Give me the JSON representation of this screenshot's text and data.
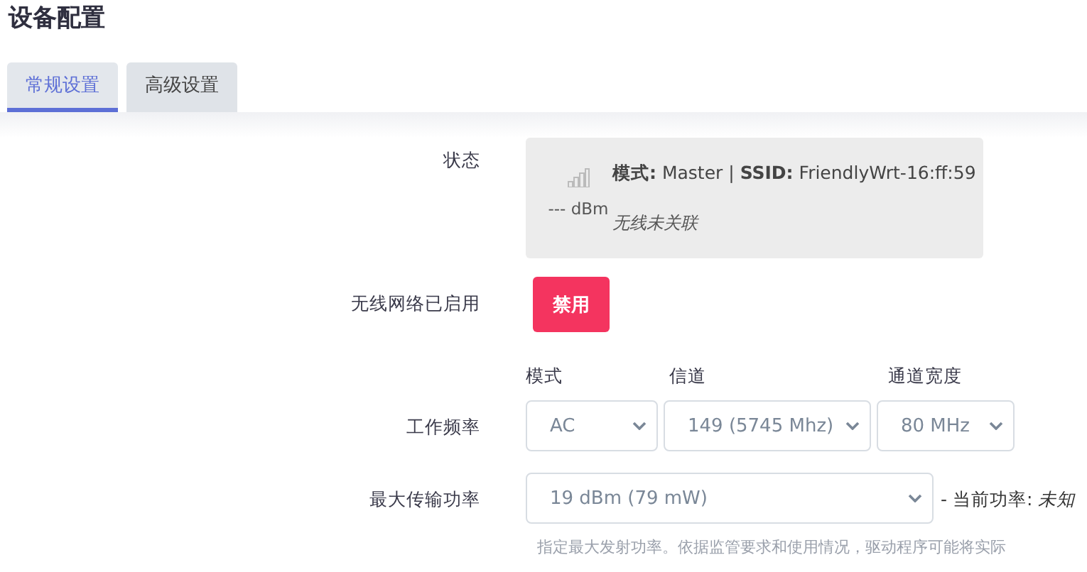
{
  "title": "设备配置",
  "tabs": [
    {
      "label": "常规设置",
      "selected": true
    },
    {
      "label": "高级设置",
      "selected": false
    }
  ],
  "status": {
    "label": "状态",
    "signal": "--- dBm",
    "info": "**模式:** Master | **SSID:** FriendlyWrt-16:ff:59",
    "association": "无线未关联"
  },
  "wireless_enabled": {
    "label": "无线网络已启用",
    "button": "禁用"
  },
  "frequency": {
    "label": "工作频率",
    "columns": [
      {
        "heading": "模式",
        "value": "AC"
      },
      {
        "heading": "信道",
        "value": "149 (5745 Mhz)"
      },
      {
        "heading": "通道宽度",
        "value": "80 MHz"
      }
    ]
  },
  "tx_power": {
    "label": "最大传输功率",
    "value": "19 dBm (79 mW)",
    "current": "- 当前功率: *未知*",
    "help": "指定最大发射功率。依据监管要求和使用情况，驱动程序可能将实际"
  }
}
